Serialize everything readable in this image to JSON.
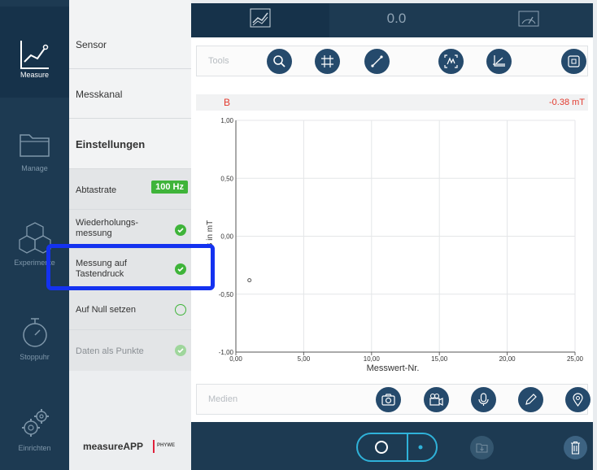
{
  "nav": {
    "items": [
      {
        "label": "Measure",
        "icon": "measure-chart-icon",
        "active": true
      },
      {
        "label": "Manage",
        "icon": "folder-icon"
      },
      {
        "label": "Experimente",
        "icon": "cubes-icon"
      },
      {
        "label": "Stoppuhr",
        "icon": "stopwatch-icon"
      },
      {
        "label": "Einrichten",
        "icon": "gears-icon"
      }
    ]
  },
  "panel": {
    "sensor": "Sensor",
    "messkanal": "Messkanal",
    "einstellungen": "Einstellungen",
    "abtastrate": {
      "label": "Abtastrate",
      "value": "100 Hz"
    },
    "wiederholung": {
      "line1": "Wiederholungs-",
      "line2": "messung",
      "state": "checked"
    },
    "tastendruck": {
      "line1": "Messung auf",
      "line2": "Tastendruck",
      "state": "checked"
    },
    "nullsetzen": {
      "label": "Auf Null setzen",
      "state": "unchecked"
    },
    "punkte": {
      "label": "Daten als Punkte",
      "state": "checked-disabled"
    },
    "logo": {
      "brand": "measureAPP",
      "company": "PHYWE",
      "brand_color": "#e0213c"
    }
  },
  "tabs": {
    "value_label": "0.0",
    "icons": [
      "graph-view-icon",
      "gauge-icon"
    ]
  },
  "tools": {
    "label": "Tools",
    "buttons": [
      "zoom-icon",
      "grid-icon",
      "line-tool-icon",
      "autoscale-icon",
      "axes-icon",
      "fullscreen-icon"
    ]
  },
  "valuebar": {
    "channel": "B",
    "value": "-0.38 mT",
    "color": "#e23a2e"
  },
  "chart_data": {
    "type": "scatter",
    "xlabel": "Messwert-Nr.",
    "ylabel": "B in mT",
    "xlim": [
      0,
      25
    ],
    "ylim": [
      -1,
      1
    ],
    "xticks": [
      "0,00",
      "5,00",
      "10,00",
      "15,00",
      "20,00",
      "25,00"
    ],
    "yticks": [
      "-1,00",
      "-0,50",
      "0,00",
      "0,50",
      "1,00"
    ],
    "grid": true,
    "series": [
      {
        "points": [
          [
            1,
            -0.38
          ]
        ]
      }
    ]
  },
  "media": {
    "label": "Medien",
    "buttons": [
      "camera-icon",
      "video-camera-icon",
      "microphone-icon",
      "pencil-icon",
      "location-icon"
    ]
  },
  "bottom": {
    "buttons": [
      "record-circle-button",
      "record-dot-button",
      "export-folder-icon",
      "trash-icon"
    ]
  }
}
